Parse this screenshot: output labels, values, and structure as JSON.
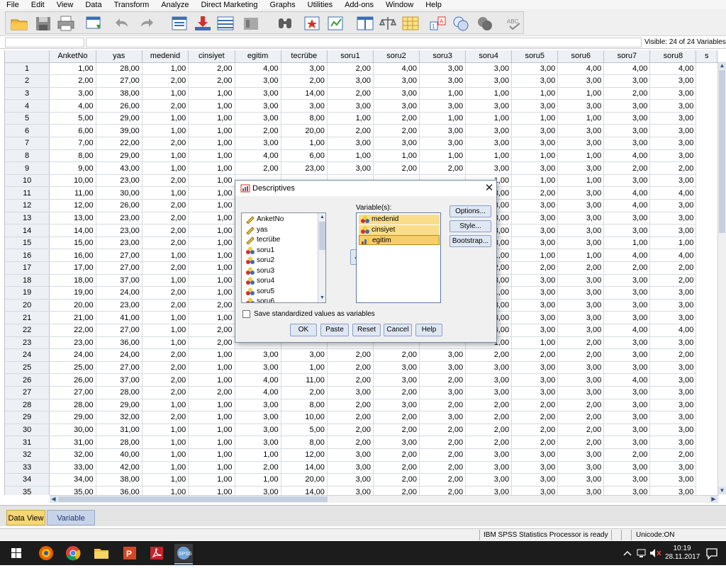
{
  "menubar": {
    "items": [
      "File",
      "Edit",
      "View",
      "Data",
      "Transform",
      "Analyze",
      "Direct Marketing",
      "Graphs",
      "Utilities",
      "Add-ons",
      "Window",
      "Help"
    ]
  },
  "cell_editor": {
    "visible_label": "Visible: 24 of 24 Variables"
  },
  "grid": {
    "columns": [
      "AnketNo",
      "yas",
      "medenid",
      "cinsiyet",
      "egitim",
      "tecrübe",
      "soru1",
      "soru2",
      "soru3",
      "soru4",
      "soru5",
      "soru6",
      "soru7",
      "soru8",
      "s"
    ],
    "rows": [
      [
        "1",
        "1,00",
        "28,00",
        "1,00",
        "2,00",
        "4,00",
        "3,00",
        "2,00",
        "4,00",
        "3,00",
        "3,00",
        "3,00",
        "4,00",
        "4,00",
        "4,00"
      ],
      [
        "2",
        "2,00",
        "27,00",
        "2,00",
        "2,00",
        "3,00",
        "2,00",
        "3,00",
        "3,00",
        "3,00",
        "3,00",
        "3,00",
        "3,00",
        "3,00",
        "3,00"
      ],
      [
        "3",
        "3,00",
        "38,00",
        "1,00",
        "1,00",
        "3,00",
        "14,00",
        "2,00",
        "3,00",
        "1,00",
        "1,00",
        "1,00",
        "1,00",
        "2,00",
        "3,00"
      ],
      [
        "4",
        "4,00",
        "26,00",
        "2,00",
        "1,00",
        "3,00",
        "3,00",
        "3,00",
        "3,00",
        "3,00",
        "3,00",
        "3,00",
        "3,00",
        "3,00",
        "3,00"
      ],
      [
        "5",
        "5,00",
        "29,00",
        "1,00",
        "1,00",
        "3,00",
        "8,00",
        "1,00",
        "2,00",
        "1,00",
        "1,00",
        "1,00",
        "1,00",
        "3,00",
        "3,00"
      ],
      [
        "6",
        "6,00",
        "39,00",
        "1,00",
        "1,00",
        "2,00",
        "20,00",
        "2,00",
        "2,00",
        "3,00",
        "3,00",
        "3,00",
        "3,00",
        "3,00",
        "3,00"
      ],
      [
        "7",
        "7,00",
        "22,00",
        "2,00",
        "1,00",
        "3,00",
        "1,00",
        "3,00",
        "3,00",
        "3,00",
        "3,00",
        "3,00",
        "3,00",
        "3,00",
        "3,00"
      ],
      [
        "8",
        "8,00",
        "29,00",
        "1,00",
        "1,00",
        "4,00",
        "6,00",
        "1,00",
        "1,00",
        "1,00",
        "1,00",
        "1,00",
        "1,00",
        "4,00",
        "3,00"
      ],
      [
        "9",
        "9,00",
        "43,00",
        "1,00",
        "1,00",
        "2,00",
        "23,00",
        "3,00",
        "2,00",
        "2,00",
        "3,00",
        "3,00",
        "3,00",
        "2,00",
        "2,00"
      ],
      [
        "10",
        "10,00",
        "23,00",
        "2,00",
        "1,00",
        "",
        "",
        "",
        "",
        "",
        "1,00",
        "1,00",
        "1,00",
        "3,00",
        "3,00"
      ],
      [
        "11",
        "11,00",
        "30,00",
        "1,00",
        "1,00",
        "",
        "",
        "",
        "",
        "",
        "3,00",
        "2,00",
        "3,00",
        "4,00",
        "4,00"
      ],
      [
        "12",
        "12,00",
        "26,00",
        "2,00",
        "1,00",
        "",
        "",
        "",
        "",
        "",
        "3,00",
        "3,00",
        "3,00",
        "4,00",
        "3,00"
      ],
      [
        "13",
        "13,00",
        "23,00",
        "2,00",
        "1,00",
        "",
        "",
        "",
        "",
        "",
        "3,00",
        "3,00",
        "3,00",
        "3,00",
        "3,00"
      ],
      [
        "14",
        "14,00",
        "23,00",
        "2,00",
        "1,00",
        "",
        "",
        "",
        "",
        "",
        "3,00",
        "3,00",
        "3,00",
        "3,00",
        "3,00"
      ],
      [
        "15",
        "15,00",
        "23,00",
        "2,00",
        "1,00",
        "",
        "",
        "",
        "",
        "",
        "3,00",
        "3,00",
        "3,00",
        "1,00",
        "1,00"
      ],
      [
        "16",
        "16,00",
        "27,00",
        "1,00",
        "1,00",
        "",
        "",
        "",
        "",
        "",
        "1,00",
        "1,00",
        "1,00",
        "4,00",
        "4,00"
      ],
      [
        "17",
        "17,00",
        "27,00",
        "2,00",
        "1,00",
        "",
        "",
        "",
        "",
        "",
        "2,00",
        "2,00",
        "2,00",
        "2,00",
        "2,00"
      ],
      [
        "18",
        "18,00",
        "37,00",
        "1,00",
        "1,00",
        "",
        "",
        "",
        "",
        "",
        "3,00",
        "3,00",
        "3,00",
        "3,00",
        "2,00"
      ],
      [
        "19",
        "19,00",
        "24,00",
        "2,00",
        "1,00",
        "",
        "",
        "",
        "",
        "",
        "1,00",
        "3,00",
        "3,00",
        "3,00",
        "3,00"
      ],
      [
        "20",
        "20,00",
        "23,00",
        "2,00",
        "2,00",
        "",
        "",
        "",
        "",
        "",
        "3,00",
        "3,00",
        "3,00",
        "3,00",
        "3,00"
      ],
      [
        "21",
        "21,00",
        "41,00",
        "1,00",
        "1,00",
        "",
        "",
        "",
        "",
        "",
        "3,00",
        "3,00",
        "3,00",
        "3,00",
        "3,00"
      ],
      [
        "22",
        "22,00",
        "27,00",
        "1,00",
        "2,00",
        "",
        "",
        "",
        "",
        "",
        "4,00",
        "3,00",
        "3,00",
        "4,00",
        "4,00"
      ],
      [
        "23",
        "23,00",
        "36,00",
        "1,00",
        "2,00",
        "",
        "",
        "",
        "",
        "",
        "1,00",
        "1,00",
        "2,00",
        "3,00",
        "3,00"
      ],
      [
        "24",
        "24,00",
        "24,00",
        "2,00",
        "1,00",
        "3,00",
        "3,00",
        "2,00",
        "2,00",
        "3,00",
        "2,00",
        "2,00",
        "2,00",
        "3,00",
        "2,00"
      ],
      [
        "25",
        "25,00",
        "27,00",
        "2,00",
        "1,00",
        "3,00",
        "1,00",
        "2,00",
        "3,00",
        "3,00",
        "3,00",
        "3,00",
        "3,00",
        "3,00",
        "3,00"
      ],
      [
        "26",
        "26,00",
        "37,00",
        "2,00",
        "1,00",
        "4,00",
        "11,00",
        "2,00",
        "3,00",
        "2,00",
        "3,00",
        "3,00",
        "3,00",
        "4,00",
        "3,00"
      ],
      [
        "27",
        "27,00",
        "28,00",
        "2,00",
        "2,00",
        "4,00",
        "2,00",
        "3,00",
        "2,00",
        "3,00",
        "3,00",
        "3,00",
        "3,00",
        "3,00",
        "3,00"
      ],
      [
        "28",
        "28,00",
        "29,00",
        "1,00",
        "1,00",
        "3,00",
        "8,00",
        "2,00",
        "3,00",
        "2,00",
        "2,00",
        "2,00",
        "2,00",
        "3,00",
        "3,00"
      ],
      [
        "29",
        "29,00",
        "32,00",
        "2,00",
        "1,00",
        "3,00",
        "10,00",
        "2,00",
        "2,00",
        "3,00",
        "2,00",
        "2,00",
        "2,00",
        "3,00",
        "3,00"
      ],
      [
        "30",
        "30,00",
        "31,00",
        "1,00",
        "1,00",
        "3,00",
        "5,00",
        "2,00",
        "2,00",
        "2,00",
        "2,00",
        "2,00",
        "2,00",
        "3,00",
        "3,00"
      ],
      [
        "31",
        "31,00",
        "28,00",
        "1,00",
        "1,00",
        "3,00",
        "8,00",
        "2,00",
        "3,00",
        "2,00",
        "2,00",
        "2,00",
        "2,00",
        "3,00",
        "3,00"
      ],
      [
        "32",
        "32,00",
        "40,00",
        "1,00",
        "1,00",
        "1,00",
        "12,00",
        "3,00",
        "2,00",
        "2,00",
        "3,00",
        "3,00",
        "3,00",
        "2,00",
        "2,00"
      ],
      [
        "33",
        "33,00",
        "42,00",
        "1,00",
        "1,00",
        "2,00",
        "14,00",
        "3,00",
        "2,00",
        "2,00",
        "3,00",
        "3,00",
        "3,00",
        "3,00",
        "3,00"
      ],
      [
        "34",
        "34,00",
        "38,00",
        "1,00",
        "1,00",
        "1,00",
        "20,00",
        "3,00",
        "2,00",
        "2,00",
        "3,00",
        "3,00",
        "3,00",
        "3,00",
        "3,00"
      ],
      [
        "35",
        "35,00",
        "36,00",
        "1,00",
        "1,00",
        "3,00",
        "14,00",
        "3,00",
        "2,00",
        "2,00",
        "3,00",
        "3,00",
        "3,00",
        "3,00",
        "3,00"
      ]
    ]
  },
  "tabs": {
    "data_view": "Data View",
    "variable_view": "Variable View"
  },
  "statusbar": {
    "processor": "IBM SPSS Statistics Processor is ready",
    "unicode": "Unicode:ON"
  },
  "taskbar": {
    "time": "10:19",
    "date": "28.11.2017"
  },
  "dialog": {
    "title": "Descriptives",
    "source_variables": [
      {
        "name": "AnketNo",
        "type": "scale"
      },
      {
        "name": "yas",
        "type": "scale"
      },
      {
        "name": "tecrübe",
        "type": "scale"
      },
      {
        "name": "soru1",
        "type": "nominal"
      },
      {
        "name": "soru2",
        "type": "nominal"
      },
      {
        "name": "soru3",
        "type": "nominal"
      },
      {
        "name": "soru4",
        "type": "nominal"
      },
      {
        "name": "soru5",
        "type": "nominal"
      },
      {
        "name": "soru6",
        "type": "nominal"
      }
    ],
    "variables_label": "Variable(s):",
    "target_variables": [
      {
        "name": "medenid",
        "type": "nominal"
      },
      {
        "name": "cinsiyet",
        "type": "nominal"
      },
      {
        "name": "egitim",
        "type": "ordinal"
      }
    ],
    "options_button": "Options...",
    "style_button": "Style...",
    "bootstrap_button": "Bootstrap...",
    "save_standardized_label": "Save standardized values as variables",
    "save_standardized_checked": false,
    "ok_button": "OK",
    "paste_button": "Paste",
    "reset_button": "Reset",
    "cancel_button": "Cancel",
    "help_button": "Help"
  },
  "colors": {
    "selection_yellow": "#f9dd8a",
    "header_blue": "#edf0f5",
    "button_blue": "#dfe7f3",
    "taskbar": "#1c1c1c"
  }
}
